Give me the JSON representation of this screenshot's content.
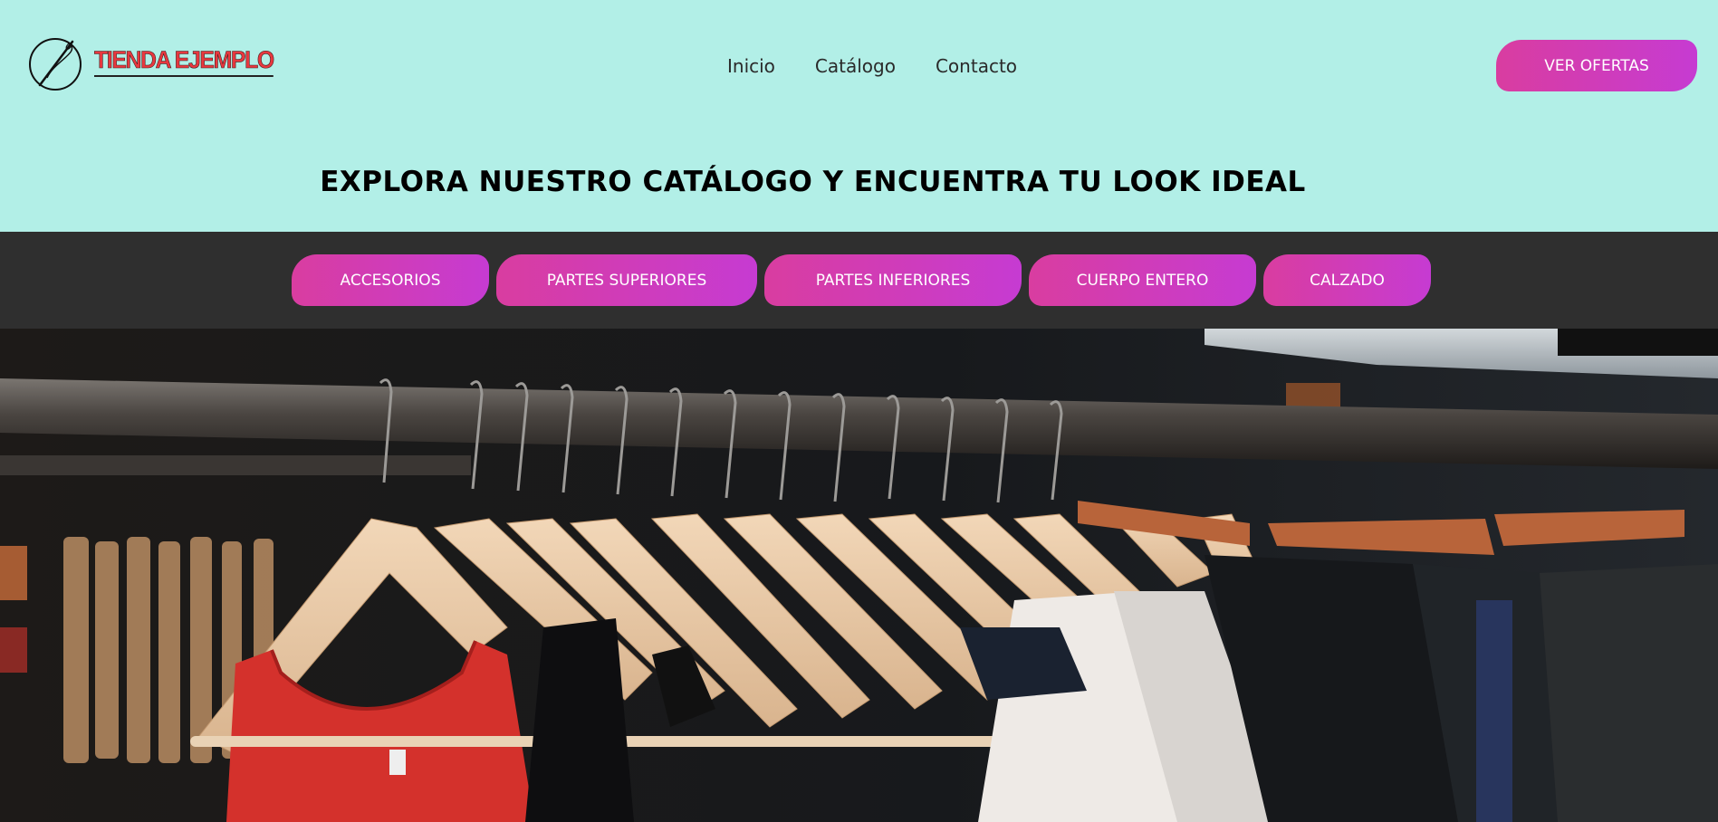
{
  "brand": {
    "name": "TIENDA EJEMPLO"
  },
  "nav": {
    "items": [
      "Inicio",
      "Catálogo",
      "Contacto"
    ]
  },
  "header": {
    "cta_label": "VER OFERTAS"
  },
  "main": {
    "headline": "EXPLORA NUESTRO CATÁLOGO Y ENCUENTRA TU LOOK IDEAL"
  },
  "categories": [
    "ACCESORIOS",
    "PARTES SUPERIORES",
    "PARTES INFERIORES",
    "CUERPO ENTERO",
    "CALZADO"
  ],
  "hero": {
    "icon": "clothes-rack-photo"
  },
  "colors": {
    "header_bg": "#b2efe7",
    "category_bar_bg": "#2f2f2f",
    "button_gradient_start": "#d93da0",
    "button_gradient_end": "#c63bd2",
    "logo_text": "#e8383f"
  }
}
